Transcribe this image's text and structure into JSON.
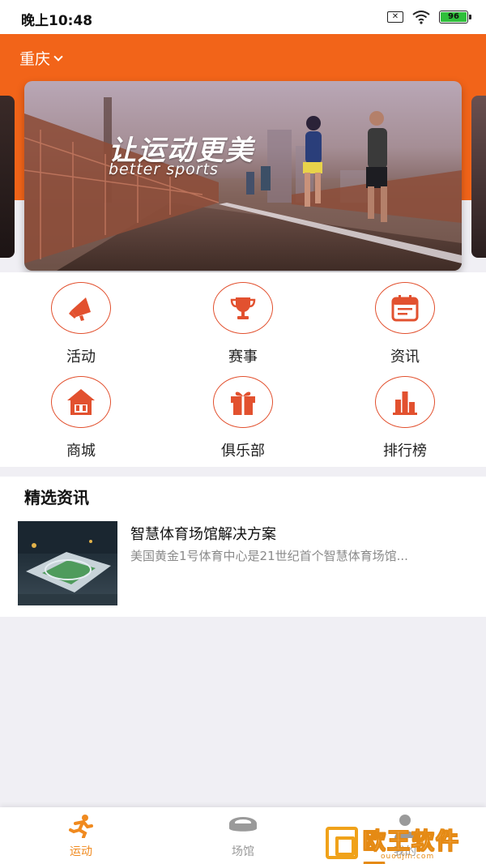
{
  "status_bar": {
    "time": "晚上10:48",
    "sim_label": "✕",
    "battery_level": "96"
  },
  "header": {
    "city": "重庆"
  },
  "banner": {
    "title": "让运动更美",
    "subtitle": "better sports"
  },
  "menu": [
    {
      "label": "活动",
      "icon": "megaphone-icon"
    },
    {
      "label": "赛事",
      "icon": "trophy-icon"
    },
    {
      "label": "资讯",
      "icon": "calendar-news-icon"
    },
    {
      "label": "商城",
      "icon": "shop-icon"
    },
    {
      "label": "俱乐部",
      "icon": "gift-icon"
    },
    {
      "label": "排行榜",
      "icon": "bar-chart-icon"
    }
  ],
  "news": {
    "section_title": "精选资讯",
    "items": [
      {
        "title": "智慧体育场馆解决方案",
        "summary": "美国黄金1号体育中心是21世纪首个智慧体育场馆..."
      }
    ]
  },
  "tabbar": {
    "tabs": [
      {
        "label": "运动",
        "active": true,
        "icon": "running-person-icon"
      },
      {
        "label": "场馆",
        "active": false,
        "icon": "stadium-icon"
      },
      {
        "label": "我的",
        "active": false,
        "icon": "user-icon"
      }
    ]
  },
  "watermark": {
    "text": "欧王软件园",
    "url": "ououjin.com"
  },
  "colors": {
    "brand_orange": "#f26419",
    "icon_red": "#e2512f",
    "tab_active": "#f08a1f",
    "page_bg": "#f0eff4"
  }
}
